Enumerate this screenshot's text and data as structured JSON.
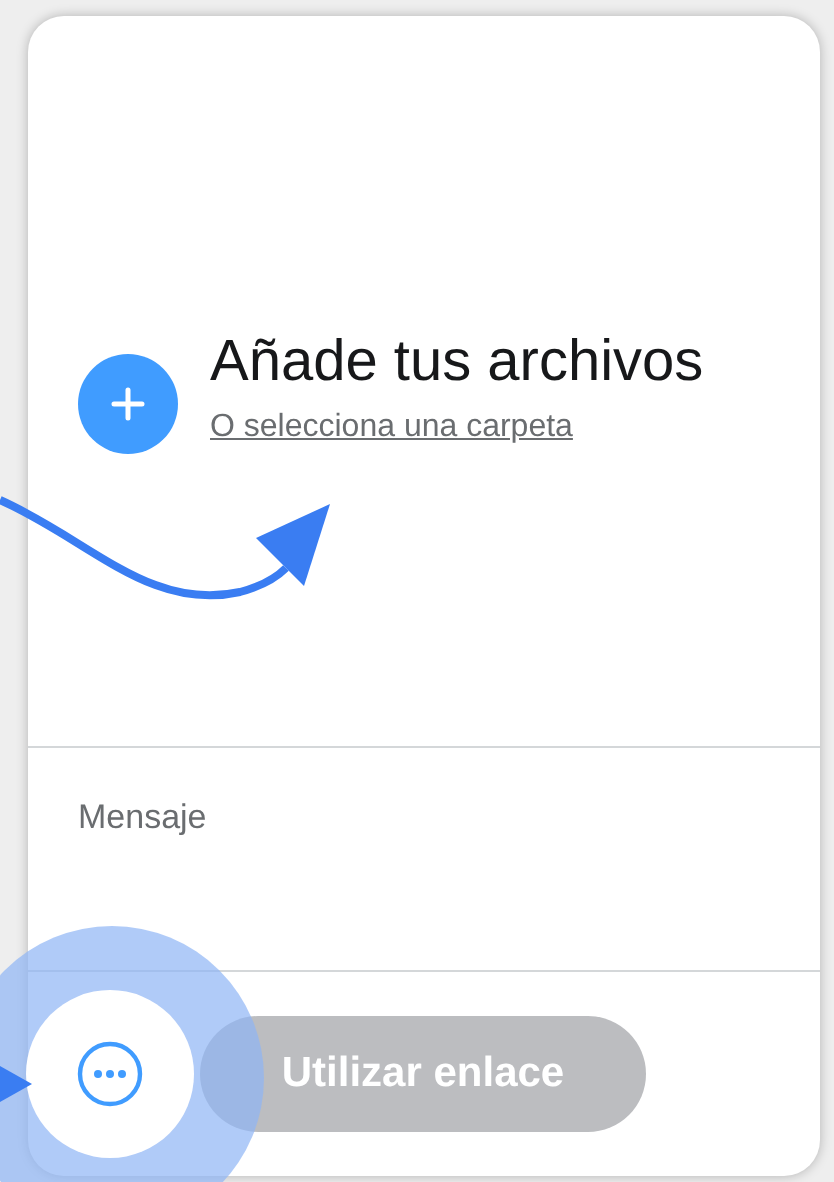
{
  "upload": {
    "title": "Añade tus archivos",
    "folder_link": "O selecciona una carpeta"
  },
  "message": {
    "placeholder": "Mensaje"
  },
  "footer": {
    "link_button": {
      "label": "Utilizar enlace",
      "disabled": true
    }
  }
}
